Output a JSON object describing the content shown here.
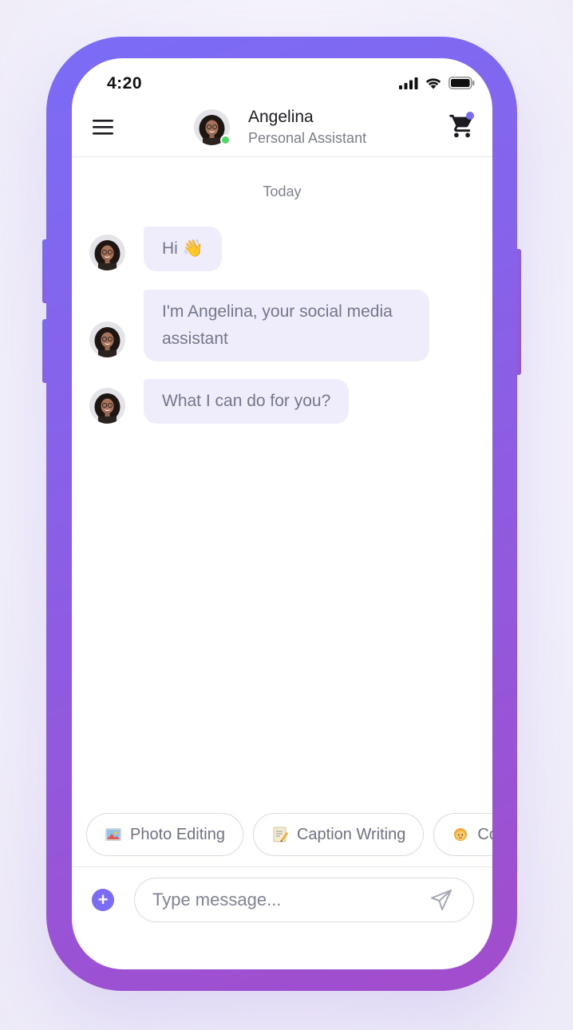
{
  "status_bar": {
    "time": "4:20"
  },
  "header": {
    "name": "Angelina",
    "role": "Personal Assistant",
    "menu_icon": "hamburger-menu-icon",
    "cart_icon": "shopping-cart-icon",
    "online_status_color": "#4cd964"
  },
  "chat": {
    "day_label": "Today",
    "messages": [
      {
        "text": "Hi 👋"
      },
      {
        "text": "I'm Angelina, your social media assistant"
      },
      {
        "text": "What I can do for you?"
      }
    ]
  },
  "chips": [
    {
      "label": "Photo Editing",
      "icon": "framed-picture-icon"
    },
    {
      "label": "Caption Writing",
      "icon": "memo-icon"
    },
    {
      "label": "Co",
      "icon": "person-icon"
    }
  ],
  "composer": {
    "placeholder": "Type message...",
    "plus_icon": "plus-icon",
    "send_icon": "send-icon"
  },
  "colors": {
    "accent": "#7b6cf6",
    "frame_gradient_end": "#a24ccc",
    "bubble_bg": "#efedfb"
  }
}
